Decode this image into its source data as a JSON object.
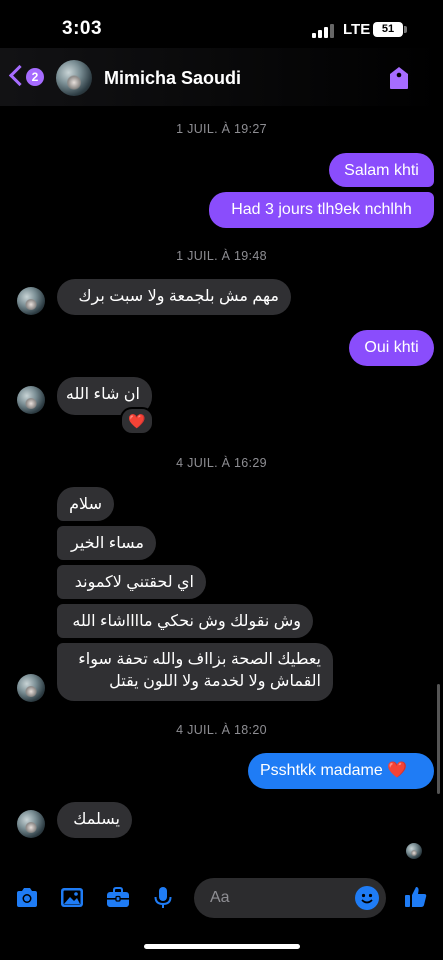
{
  "status_bar": {
    "time": "3:03",
    "network": "LTE",
    "battery": "51"
  },
  "header": {
    "back_badge": "2",
    "contact_name": "Mimicha Saoudi"
  },
  "timestamps": [
    "1 JUIL. À 19:27",
    "1 JUIL. À 19:48",
    "4 JUIL. À 16:29",
    "4 JUIL. À 18:20"
  ],
  "messages": [
    {
      "from": "me",
      "text": "Salam khti"
    },
    {
      "from": "me",
      "text": "Had 3 jours tlh9ek nchlhh"
    },
    {
      "from": "them",
      "text": "مهم مش بلجمعة ولا سبت برك"
    },
    {
      "from": "me",
      "text": "Oui khti"
    },
    {
      "from": "them",
      "text": "ان شاء الله",
      "reaction": "❤️"
    },
    {
      "from": "them",
      "text": "سلام"
    },
    {
      "from": "them",
      "text": "مساء الخير"
    },
    {
      "from": "them",
      "text": "اي لحقتني لاكموند"
    },
    {
      "from": "them",
      "text": "وش نقولك وش نحكي مااااشاء الله"
    },
    {
      "from": "them",
      "text_line1": "يعطيك الصحة بزااف والله تحفة سواء",
      "text_line2": "القماش ولا لخدمة ولا اللون يقتل"
    },
    {
      "from": "me",
      "text": "Psshtkk madame ❤️"
    },
    {
      "from": "them",
      "text": "يسلمك"
    }
  ],
  "composer": {
    "placeholder": "Aa"
  },
  "colors": {
    "accent_purple": "#8a4dfc",
    "accent_blue": "#1f7cf5",
    "incoming_bubble": "#303033"
  },
  "icons": [
    "chevron-left-icon",
    "tag-icon",
    "camera-icon",
    "gallery-icon",
    "briefcase-icon",
    "microphone-icon",
    "emoji-icon",
    "thumbs-up-icon"
  ]
}
